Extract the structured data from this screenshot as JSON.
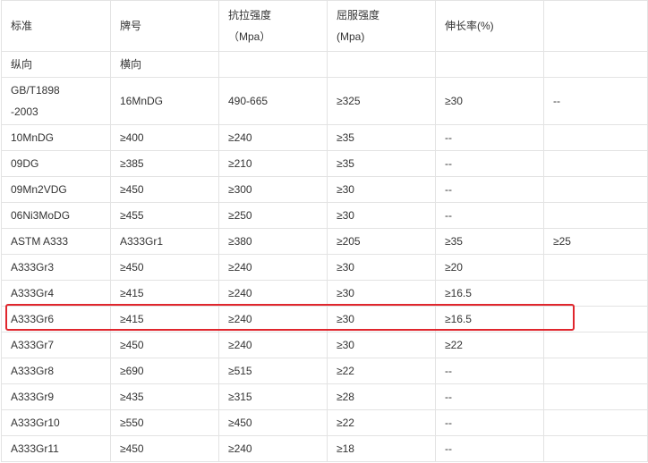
{
  "header": {
    "c1": "标准",
    "c2": "牌号",
    "c3a": "抗拉强度",
    "c3b": "（Mpa）",
    "c4a": "屈服强度",
    "c4b": "(Mpa)",
    "c5": "伸长率(%)",
    "c6": ""
  },
  "subheader": {
    "c1": "纵向",
    "c2": "横向"
  },
  "first_row": {
    "c1a": "GB/T1898",
    "c1b": "-2003",
    "c2": "16MnDG",
    "c3": "490-665",
    "c4": "≥325",
    "c5": "≥30",
    "c6": "--"
  },
  "rows": [
    [
      "10MnDG",
      "≥400",
      "≥240",
      "≥35",
      "--",
      ""
    ],
    [
      "09DG",
      "≥385",
      "≥210",
      "≥35",
      "--",
      ""
    ],
    [
      "09Mn2VDG",
      "≥450",
      "≥300",
      "≥30",
      "--",
      ""
    ],
    [
      "06Ni3MoDG",
      "≥455",
      "≥250",
      "≥30",
      "--",
      ""
    ],
    [
      "ASTM A333",
      "A333Gr1",
      "≥380",
      "≥205",
      "≥35",
      "≥25"
    ],
    [
      "A333Gr3",
      "≥450",
      "≥240",
      "≥30",
      "≥20",
      ""
    ],
    [
      "A333Gr4",
      "≥415",
      "≥240",
      "≥30",
      "≥16.5",
      ""
    ],
    [
      "A333Gr6",
      "≥415",
      "≥240",
      "≥30",
      "≥16.5",
      ""
    ],
    [
      "A333Gr7",
      "≥450",
      "≥240",
      "≥30",
      "≥22",
      ""
    ],
    [
      "A333Gr8",
      "≥690",
      "≥515",
      "≥22",
      "--",
      ""
    ],
    [
      "A333Gr9",
      "≥435",
      "≥315",
      "≥28",
      "--",
      ""
    ],
    [
      "A333Gr10",
      "≥550",
      "≥450",
      "≥22",
      "--",
      ""
    ],
    [
      "A333Gr11",
      "≥450",
      "≥240",
      "≥18",
      "--",
      ""
    ]
  ],
  "highlight_color": "#e0262d",
  "border_color": "#e3e3e3",
  "text_color": "#333333"
}
